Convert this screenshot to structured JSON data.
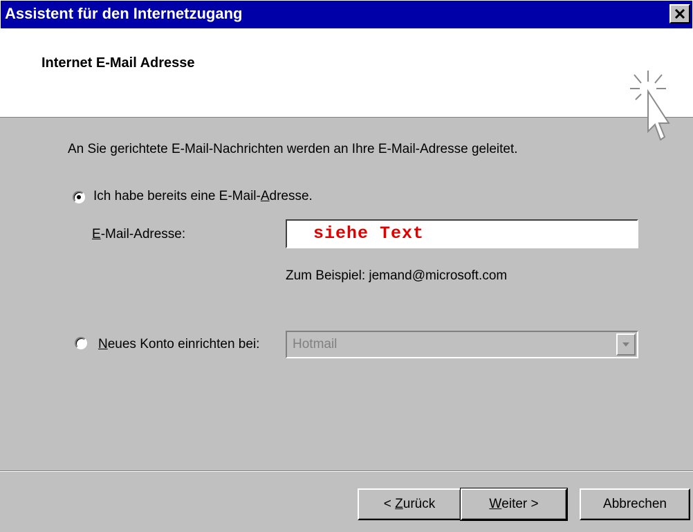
{
  "window": {
    "title": "Assistent für den Internetzugang",
    "close_icon": "close-x-icon"
  },
  "header": {
    "title": "Internet E-Mail Adresse",
    "icon": "wizard-cursor-sparkle-icon"
  },
  "body": {
    "intro": "An Sie gerichtete E-Mail-Nachrichten werden an Ihre E-Mail-Adresse geleitet.",
    "option_existing": {
      "label_before": "Ich habe bereits eine E-Mail-",
      "label_accel": "A",
      "label_after": "dresse.",
      "selected": true
    },
    "email_field": {
      "label_accel": "E",
      "label_after": "-Mail-Adresse:",
      "value": "siehe Text",
      "value_color": "#e00000"
    },
    "example": "Zum Beispiel: jemand@microsoft.com",
    "option_new": {
      "label_accel": "N",
      "label_after": "eues Konto einrichten bei:",
      "selected": false
    },
    "provider_select": {
      "value": "Hotmail",
      "disabled": true
    }
  },
  "buttons": {
    "back": {
      "prefix": "< ",
      "accel": "Z",
      "rest": "urück"
    },
    "next": {
      "accel": "W",
      "rest": "eiter >"
    },
    "cancel": {
      "label": "Abbrechen"
    }
  },
  "colors": {
    "title_bar": "#0000a8",
    "dialog_face": "#c0c0c0",
    "header_bg": "#ffffff"
  }
}
